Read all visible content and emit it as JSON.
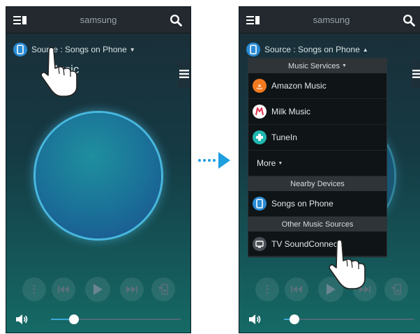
{
  "left_screen": {
    "header": {
      "title": "samsung"
    },
    "source": {
      "label": "Source : Songs on Phone",
      "caret": "▼"
    },
    "track_title": "Music",
    "volume": {
      "level": 0.18
    }
  },
  "right_screen": {
    "header": {
      "title": "samsung"
    },
    "source": {
      "label": "Source : Songs on Phone",
      "caret": "▲"
    },
    "dropdown": {
      "sections": [
        {
          "header": "Music Services",
          "header_caret": "▼",
          "items": [
            {
              "label": "Amazon Music",
              "icon": "amazon-icon",
              "color": "#f47a20"
            },
            {
              "label": "Milk Music",
              "icon": "milk-icon",
              "color": "#ffffff"
            },
            {
              "label": "TuneIn",
              "icon": "tunein-icon",
              "color": "#21b6b0"
            }
          ],
          "more_label": "More",
          "more_caret": "▼"
        },
        {
          "header": "Nearby Devices",
          "items": [
            {
              "label": "Songs on Phone",
              "icon": "phone-icon",
              "color": "#2a8bd4"
            }
          ]
        },
        {
          "header": "Other Music Sources",
          "items": [
            {
              "label": "TV SoundConnect",
              "icon": "tv-icon",
              "color": "#4a5156"
            }
          ]
        }
      ]
    },
    "volume": {
      "level": 0.08
    }
  },
  "colors": {
    "accent": "#3ea9d8",
    "arrow": "#1e9fe0",
    "source_icon": "#2a8bd4"
  }
}
